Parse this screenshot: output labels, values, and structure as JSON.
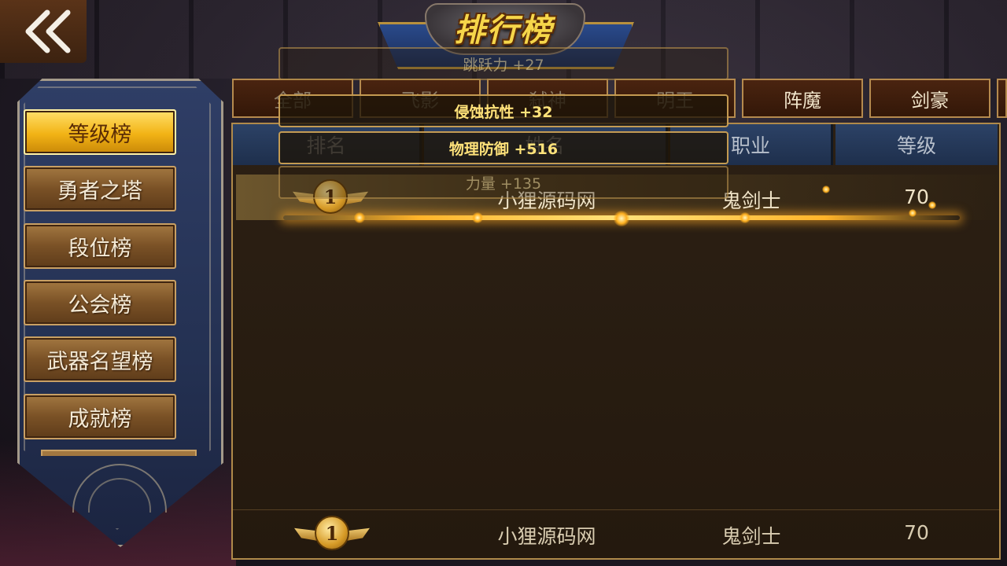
{
  "title": "排行榜",
  "sidebar": {
    "items": [
      {
        "label": "等级榜",
        "active": true
      },
      {
        "label": "勇者之塔"
      },
      {
        "label": "段位榜"
      },
      {
        "label": "公会榜"
      },
      {
        "label": "武器名望榜"
      },
      {
        "label": "成就榜"
      }
    ]
  },
  "tabs": [
    "全部",
    "飞影",
    "弑神",
    "明王",
    "阵魔",
    "剑豪"
  ],
  "table": {
    "headers": [
      "排名",
      "姓名",
      "职业",
      "等级"
    ],
    "rows": [
      {
        "rank": "1",
        "name": "小狸源码网",
        "class": "鬼剑士",
        "level": "70"
      }
    ]
  },
  "my_rank": {
    "rank": "1",
    "name": "小狸源码网",
    "class": "鬼剑士",
    "level": "70"
  },
  "attribute_popups": [
    "跳跃力 +27",
    "侵蚀抗性 +32",
    "物理防御 +516",
    "力量 +135"
  ],
  "colors": {
    "active_gold": "#f2b315",
    "tab_border": "#b58a4e",
    "header_blue": "#2c4266",
    "accent_text": "#ffe27a"
  }
}
